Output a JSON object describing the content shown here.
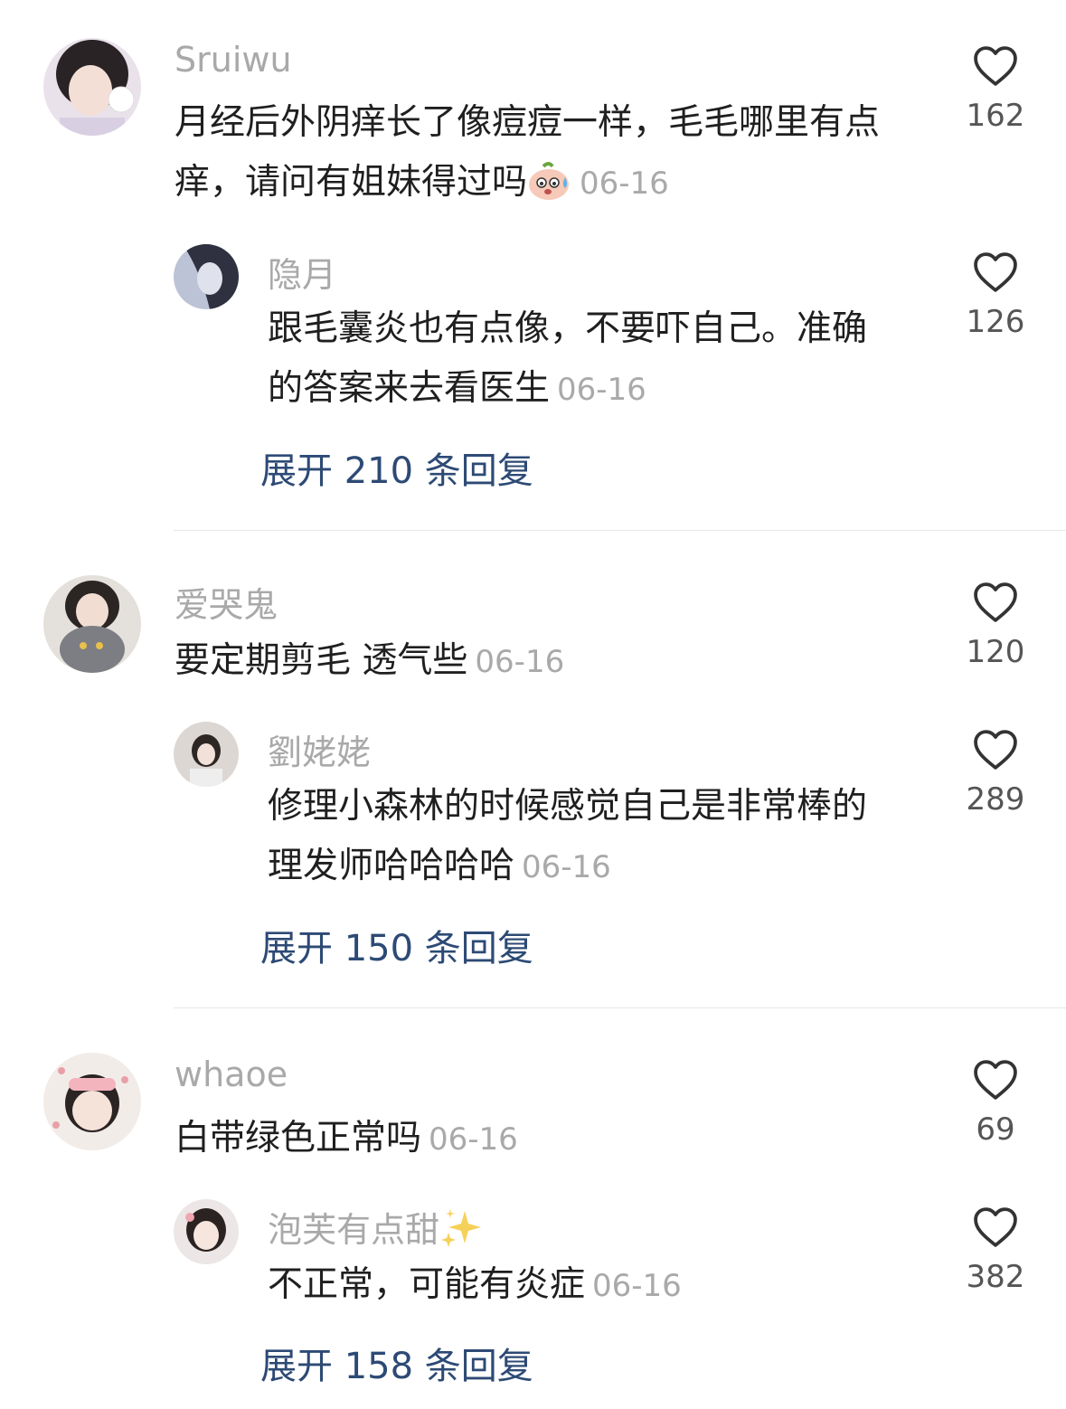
{
  "comments": [
    {
      "user": "Sruiwu",
      "text": "月经后外阴痒长了像痘痘一样，毛毛哪里有点痒，请问有姐妹得过吗",
      "date": "06-16",
      "likes": "162",
      "reply": {
        "user": "隐月",
        "text": "跟毛囊炎也有点像，不要吓自己。准确的答案来去看医生",
        "date": "06-16",
        "likes": "126"
      },
      "expand": "展开 210 条回复"
    },
    {
      "user": "爱哭鬼",
      "text": "要定期剪毛 透气些",
      "date": "06-16",
      "likes": "120",
      "reply": {
        "user": "劉姥姥",
        "text": "修理小森林的时候感觉自己是非常棒的理发师哈哈哈哈",
        "date": "06-16",
        "likes": "289"
      },
      "expand": "展开 150 条回复"
    },
    {
      "user": "whaoe",
      "text": "白带绿色正常吗",
      "date": "06-16",
      "likes": "69",
      "reply": {
        "user": "泡芙有点甜",
        "text": "不正常，可能有炎症",
        "date": "06-16",
        "likes": "382"
      },
      "expand": "展开 158 条回复"
    }
  ],
  "icons": {
    "like": "heart-outline-icon",
    "sparkle": "sparkles-emoji",
    "sweat": "sweat-face-emoji"
  },
  "colors": {
    "expand_link": "#2d4a75",
    "muted": "#a9a9a9"
  }
}
